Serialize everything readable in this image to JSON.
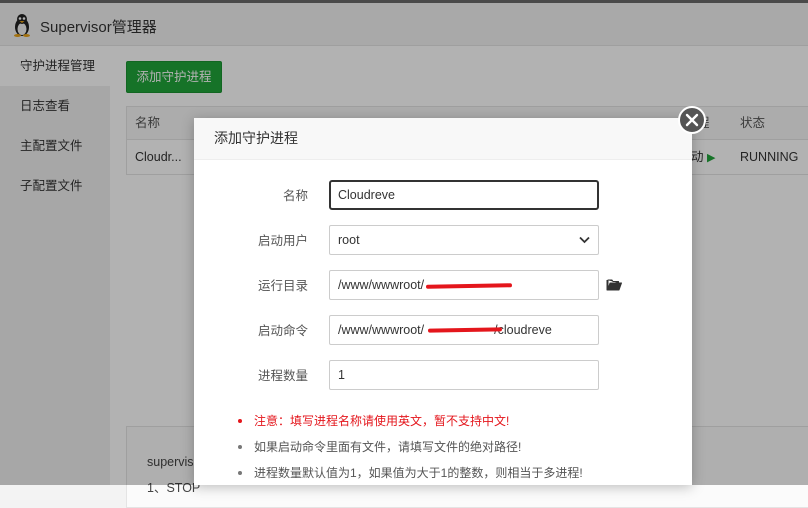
{
  "app": {
    "title": "Supervisor管理器",
    "icon": "tux-penguin-icon"
  },
  "sidebar": {
    "items": [
      {
        "label": "守护进程管理",
        "active": true
      },
      {
        "label": "日志查看",
        "active": false
      },
      {
        "label": "主配置文件",
        "active": false
      },
      {
        "label": "子配置文件",
        "active": false
      }
    ]
  },
  "main": {
    "add_button": "添加守护进程",
    "table": {
      "headers": {
        "name": "名称",
        "manage_partial": "程",
        "status": "状态"
      },
      "row": {
        "name": "Cloudr...",
        "action_partial": "动",
        "status": "RUNNING"
      }
    },
    "info": {
      "line1": "supervis",
      "line2": "1、STOP"
    }
  },
  "modal": {
    "title": "添加守护进程",
    "fields": {
      "name": {
        "label": "名称",
        "value": "Cloudreve"
      },
      "user": {
        "label": "启动用户",
        "value": "root"
      },
      "dir": {
        "label": "运行目录",
        "value": "/www/wwwroot/"
      },
      "command": {
        "label": "启动命令",
        "value_prefix": "/www/wwwroot/",
        "value_suffix": "/cloudreve"
      },
      "count": {
        "label": "进程数量",
        "value": "1"
      }
    },
    "notes": [
      "注意：填写进程名称请使用英文，暂不支持中文!",
      "如果启动命令里面有文件，请填写文件的绝对路径!",
      "进程数量默认值为1，如果值为大于1的整数，则相当于多进程!"
    ]
  },
  "colors": {
    "accent": "#20a53a",
    "warning": "#e4161c",
    "redaction": "#e4161c"
  },
  "icons": {
    "close": "close-icon",
    "folder": "folder-open-icon",
    "select": "chevron-down-icon",
    "play": "play-icon"
  }
}
